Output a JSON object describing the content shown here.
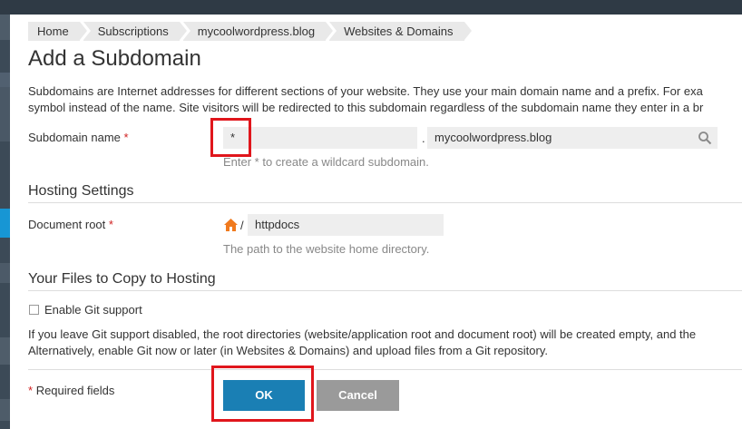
{
  "breadcrumbs": [
    "Home",
    "Subscriptions",
    "mycoolwordpress.blog",
    "Websites & Domains"
  ],
  "page_title": "Add a Subdomain",
  "intro": {
    "line1": "Subdomains are Internet addresses for different sections of your website. They use your main domain name and a prefix. For exa",
    "line2": "symbol instead of the name. Site visitors will be redirected to this subdomain regardless of the subdomain name they enter in a br"
  },
  "subdomain": {
    "label": "Subdomain name",
    "required_mark": "*",
    "value": "*",
    "separator": ".",
    "domain_value": "mycoolwordpress.blog",
    "hint": "Enter * to create a wildcard subdomain."
  },
  "hosting": {
    "section_title": "Hosting Settings",
    "docroot_label": "Document root",
    "required_mark": "*",
    "path_separator": "/",
    "docroot_value": "httpdocs",
    "hint": "The path to the website home directory."
  },
  "files": {
    "section_title": "Your Files to Copy to Hosting",
    "git_checkbox_label": "Enable Git support",
    "git_checked": false,
    "note_line1": "If you leave Git support disabled, the root directories (website/application root and document root) will be created empty, and the",
    "note_line2": "Alternatively, enable Git now or later (in Websites & Domains) and upload files from a Git repository."
  },
  "footer": {
    "required_note_mark": "*",
    "required_note": "Required fields",
    "ok_label": "OK",
    "cancel_label": "Cancel"
  },
  "colors": {
    "highlight": "#e0161c",
    "ok_button": "#1a7fb4",
    "cancel_button": "#9a9a9a",
    "required": "#d02020"
  },
  "icons": {
    "search": "search-icon",
    "home": "home-icon"
  }
}
